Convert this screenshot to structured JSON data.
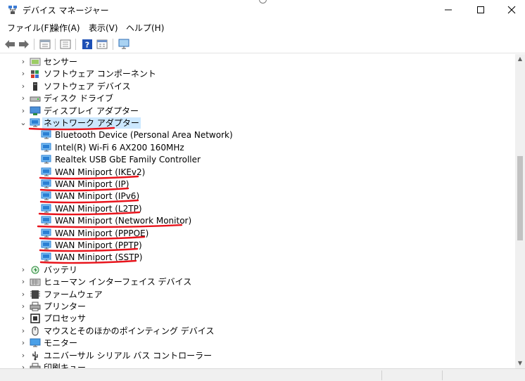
{
  "window": {
    "title": "デバイス マネージャー",
    "app_icon": "device-manager-icon",
    "controls": [
      "minimize",
      "maximize",
      "close"
    ]
  },
  "menu": {
    "items": [
      "ファイル(F)",
      "操作(A)",
      "表示(V)",
      "ヘルプ(H)"
    ]
  },
  "toolbar": {
    "buttons": [
      "back-arrow",
      "forward-arrow",
      "properties",
      "console-tree",
      "help",
      "view-grid",
      "monitor-scan"
    ]
  },
  "tree": {
    "partial_top_item": "",
    "items": [
      {
        "label": "センサー",
        "expander": "›",
        "icon": "sensor-icon",
        "level": 0
      },
      {
        "label": "ソフトウェア コンポーネント",
        "expander": "›",
        "icon": "software-component-icon",
        "level": 0
      },
      {
        "label": "ソフトウェア デバイス",
        "expander": "›",
        "icon": "software-device-icon",
        "level": 0
      },
      {
        "label": "ディスク ドライブ",
        "expander": "›",
        "icon": "disk-drive-icon",
        "level": 0
      },
      {
        "label": "ディスプレイ アダプター",
        "expander": "›",
        "icon": "display-adapter-icon",
        "level": 0
      },
      {
        "label": "ネットワーク アダプター",
        "expander": "⌄",
        "icon": "network-adapter-icon",
        "level": 0,
        "selected": true
      },
      {
        "label": "Bluetooth Device (Personal Area Network)",
        "icon": "network-adapter-icon",
        "level": 1
      },
      {
        "label": "Intel(R) Wi-Fi 6 AX200 160MHz",
        "icon": "network-adapter-icon",
        "level": 1
      },
      {
        "label": "Realtek USB GbE Family Controller",
        "icon": "network-adapter-icon",
        "level": 1
      },
      {
        "label": "WAN Miniport (IKEv2)",
        "icon": "network-adapter-icon",
        "level": 1
      },
      {
        "label": "WAN Miniport (IP)",
        "icon": "network-adapter-icon",
        "level": 1
      },
      {
        "label": "WAN Miniport (IPv6)",
        "icon": "network-adapter-icon",
        "level": 1
      },
      {
        "label": "WAN Miniport (L2TP)",
        "icon": "network-adapter-icon",
        "level": 1
      },
      {
        "label": "WAN Miniport (Network Monitor)",
        "icon": "network-adapter-icon",
        "level": 1
      },
      {
        "label": "WAN Miniport (PPPOE)",
        "icon": "network-adapter-icon",
        "level": 1
      },
      {
        "label": "WAN Miniport (PPTP)",
        "icon": "network-adapter-icon",
        "level": 1
      },
      {
        "label": "WAN Miniport (SSTP)",
        "icon": "network-adapter-icon",
        "level": 1
      },
      {
        "label": "バッテリ",
        "expander": "›",
        "icon": "battery-icon",
        "level": 0
      },
      {
        "label": "ヒューマン インターフェイス デバイス",
        "expander": "›",
        "icon": "hid-icon",
        "level": 0
      },
      {
        "label": "ファームウェア",
        "expander": "›",
        "icon": "firmware-icon",
        "level": 0
      },
      {
        "label": "プリンター",
        "expander": "›",
        "icon": "printer-icon",
        "level": 0
      },
      {
        "label": "プロセッサ",
        "expander": "›",
        "icon": "processor-icon",
        "level": 0
      },
      {
        "label": "マウスとそのほかのポインティング デバイス",
        "expander": "›",
        "icon": "mouse-icon",
        "level": 0
      },
      {
        "label": "モニター",
        "expander": "›",
        "icon": "monitor-icon",
        "level": 0
      },
      {
        "label": "ユニバーサル シリアル バス コントローラー",
        "expander": "›",
        "icon": "usb-icon",
        "level": 0
      },
      {
        "label": "印刷キュー",
        "expander": "›",
        "icon": "print-queue-icon",
        "level": 0
      }
    ]
  },
  "colors": {
    "selection": "#cce8ff",
    "annotation_red": "#e8141c",
    "adapter_blue": "#2a7fd4"
  }
}
